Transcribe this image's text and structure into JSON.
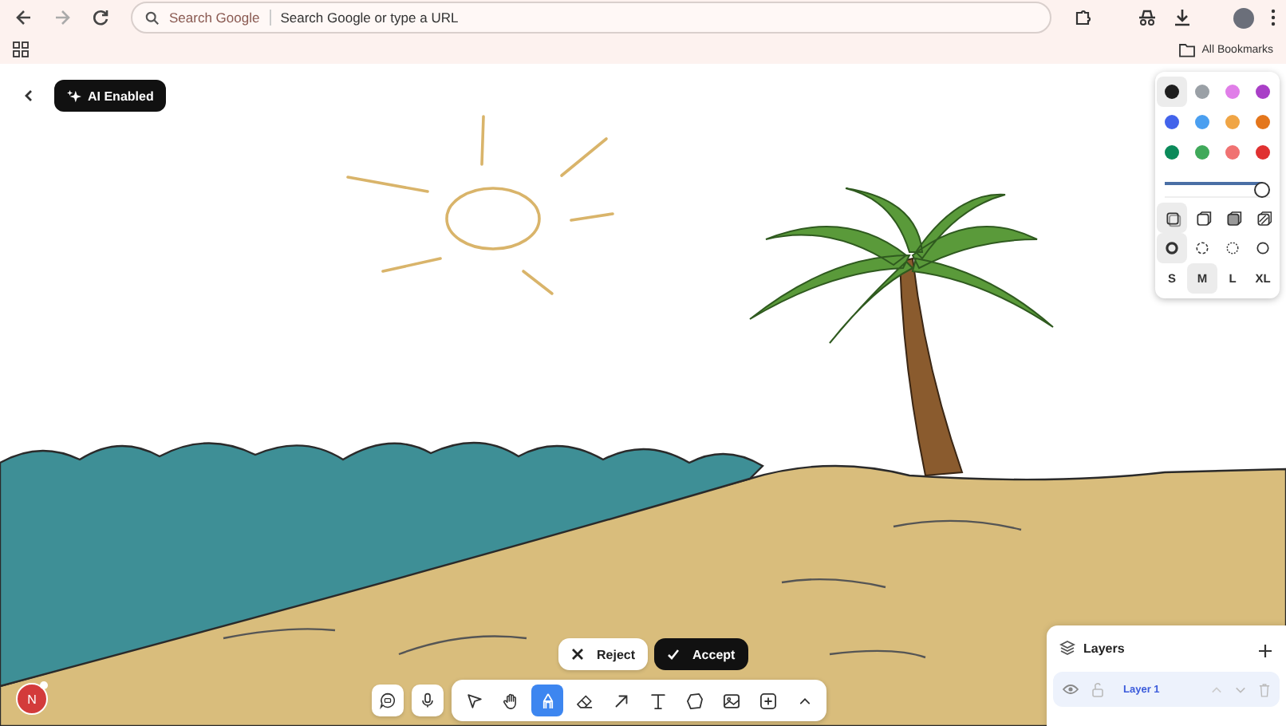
{
  "browser": {
    "search_chip": "Search Google",
    "address_placeholder": "Search Google or type a URL",
    "bookmarks": "All Bookmarks"
  },
  "ai_badge": "AI Enabled",
  "palette": {
    "colors": [
      {
        "color": "#1e1e1e",
        "selected": true
      },
      {
        "color": "#9aa0a6",
        "selected": false
      },
      {
        "color": "#e07ee8",
        "selected": false
      },
      {
        "color": "#a93fc7",
        "selected": false
      },
      {
        "color": "#4263eb",
        "selected": false
      },
      {
        "color": "#4a9ff0",
        "selected": false
      },
      {
        "color": "#f0a545",
        "selected": false
      },
      {
        "color": "#e4761b",
        "selected": false
      },
      {
        "color": "#0b8a5a",
        "selected": false
      },
      {
        "color": "#40a95a",
        "selected": false
      },
      {
        "color": "#f07272",
        "selected": false
      },
      {
        "color": "#e03131",
        "selected": false
      }
    ],
    "stroke_width": {
      "level": 1.0
    },
    "fill_styles": [
      {
        "kind": "none",
        "selected": true
      },
      {
        "kind": "semi",
        "selected": false
      },
      {
        "kind": "solid",
        "selected": false
      },
      {
        "kind": "pattern",
        "selected": false
      }
    ],
    "stroke_styles": [
      {
        "kind": "draw",
        "selected": true
      },
      {
        "kind": "dashed",
        "selected": false
      },
      {
        "kind": "dotted",
        "selected": false
      },
      {
        "kind": "solid",
        "selected": false
      }
    ],
    "sizes": [
      {
        "label": "S",
        "selected": false
      },
      {
        "label": "M",
        "selected": true
      },
      {
        "label": "L",
        "selected": false
      },
      {
        "label": "XL",
        "selected": false
      }
    ]
  },
  "suggestion": {
    "reject": "Reject",
    "accept": "Accept"
  },
  "side_tools": [
    {
      "kind": "chat"
    },
    {
      "kind": "mic"
    }
  ],
  "tools": [
    {
      "kind": "select",
      "selected": false
    },
    {
      "kind": "hand",
      "selected": false
    },
    {
      "kind": "pen",
      "selected": true
    },
    {
      "kind": "eraser",
      "selected": false
    },
    {
      "kind": "arrow",
      "selected": false
    },
    {
      "kind": "text",
      "selected": false
    },
    {
      "kind": "shape",
      "selected": false
    },
    {
      "kind": "image",
      "selected": false
    },
    {
      "kind": "add",
      "selected": false
    },
    {
      "kind": "more",
      "selected": false
    }
  ],
  "layers": {
    "title": "Layers",
    "items": [
      {
        "name": "Layer 1",
        "selected": true
      }
    ]
  },
  "user": {
    "initial": "N"
  }
}
